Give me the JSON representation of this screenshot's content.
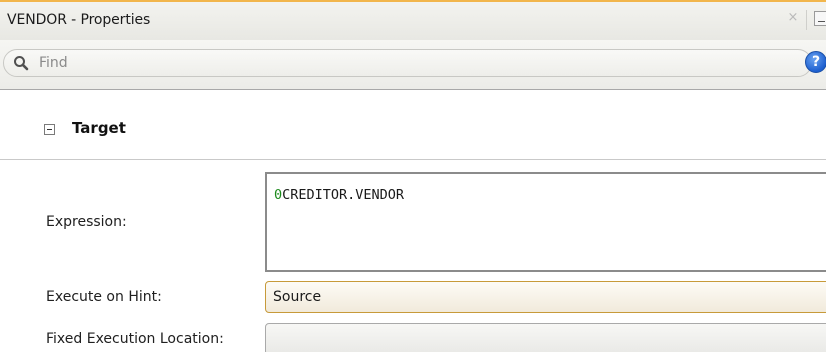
{
  "window": {
    "title": "VENDOR - Properties"
  },
  "search": {
    "placeholder": "Find"
  },
  "section": {
    "title": "Target"
  },
  "fields": {
    "expression_label": "Expression:",
    "expression_prefix": "0",
    "expression_rest": "CREDITOR.VENDOR",
    "execute_hint_label": "Execute on Hint:",
    "execute_hint_value": "Source",
    "fixed_location_label": "Fixed Execution Location:",
    "fixed_location_value": ""
  },
  "icons": {
    "search": "search-icon",
    "help": "help-icon",
    "close": "close-icon",
    "minimize": "minimize-icon",
    "collapse": "collapse-icon"
  },
  "colors": {
    "accent": "#f2b64c",
    "help_blue": "#1d5fcf",
    "expression_zero": "#1c8a1c"
  }
}
